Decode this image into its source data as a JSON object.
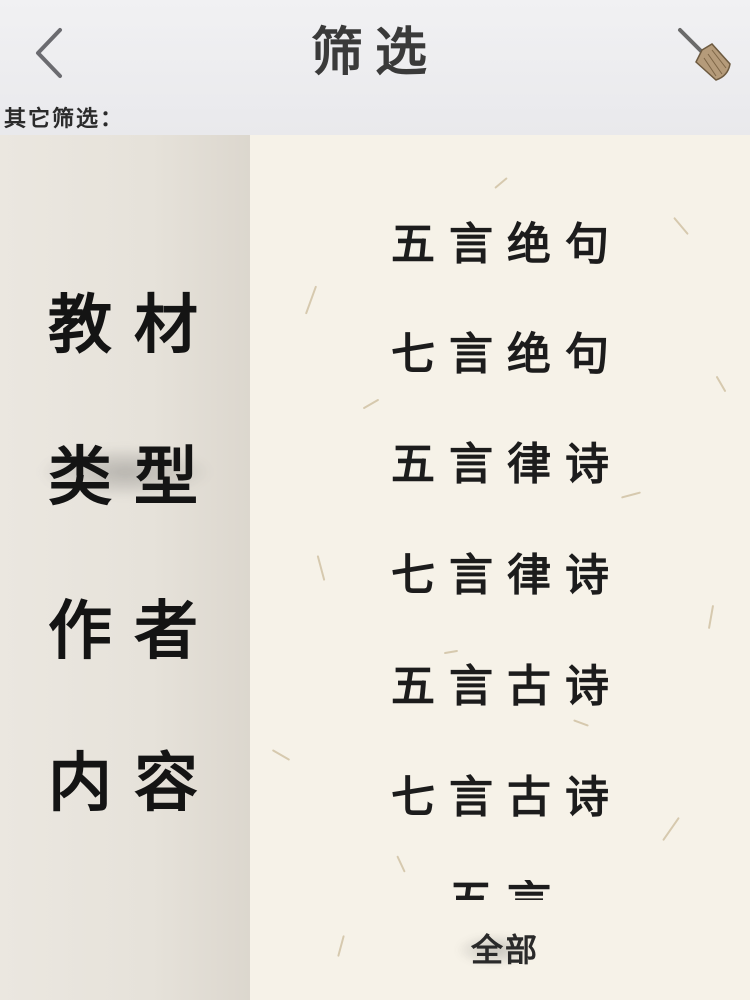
{
  "header": {
    "title": "筛选",
    "back_icon": "chevron-left-icon",
    "clear_icon": "broom-icon"
  },
  "other_filter_label": "其它筛选：",
  "categories": [
    {
      "label": "教材",
      "selected": false
    },
    {
      "label": "类型",
      "selected": true
    },
    {
      "label": "作者",
      "selected": false
    },
    {
      "label": "内容",
      "selected": false
    }
  ],
  "types": [
    {
      "label": "五言绝句"
    },
    {
      "label": "七言绝句"
    },
    {
      "label": "五言律诗"
    },
    {
      "label": "七言律诗"
    },
    {
      "label": "五言古诗"
    },
    {
      "label": "七言古诗"
    },
    {
      "label": "五言"
    }
  ],
  "all_button": "全部",
  "colors": {
    "header_bg": "#ececef",
    "left_panel_bg": "#e8e4dc",
    "right_panel_bg": "#f6f2e8",
    "text": "#1c1c1c"
  }
}
